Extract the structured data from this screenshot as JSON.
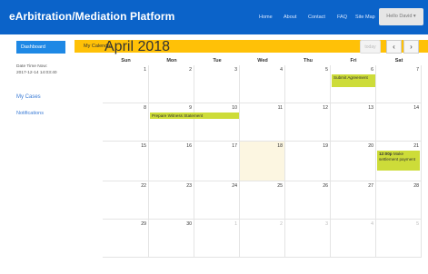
{
  "header": {
    "brand": "eArbitration/Mediation Platform",
    "nav": [
      "Home",
      "About",
      "Contact",
      "FAQ",
      "Site Map"
    ],
    "user_button": "Hello David ▾"
  },
  "sidebar": {
    "dashboard": "Dashboard",
    "datetime_label": "Date Time Now:",
    "datetime_value": "2017-12-14 14:03:40",
    "my_cases": "My Cases",
    "notifications": "Notifications"
  },
  "main": {
    "banner": "My Calendar",
    "month_title": "April 2018",
    "today_label": "today",
    "prev_label": "‹",
    "next_label": "›",
    "weekdays": [
      "Sun",
      "Mon",
      "Tue",
      "Wed",
      "Thu",
      "Fri",
      "Sat"
    ],
    "weeks": [
      [
        "1",
        "2",
        "3",
        "4",
        "5",
        "6",
        "7"
      ],
      [
        "8",
        "9",
        "10",
        "11",
        "12",
        "13",
        "14"
      ],
      [
        "15",
        "16",
        "17",
        "18",
        "19",
        "20",
        "21"
      ],
      [
        "22",
        "23",
        "24",
        "25",
        "26",
        "27",
        "28"
      ],
      [
        "29",
        "30",
        "1",
        "2",
        "3",
        "4",
        "5"
      ]
    ],
    "events": {
      "submit_agreement": "Submit Agreement",
      "witness_statement": "Prepare Witness Statement",
      "settlement_time": "12:00p",
      "settlement_text": "Make settlement payment"
    }
  },
  "colors": {
    "header": "#0b63c9",
    "active_nav": "#1e88e5",
    "banner": "#ffc107",
    "event": "#cddc39",
    "today_cell": "#fcf6e1"
  }
}
